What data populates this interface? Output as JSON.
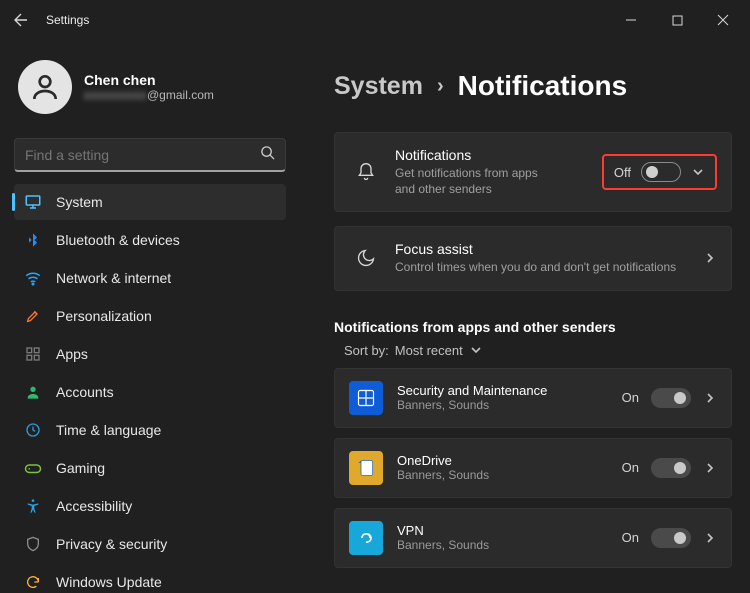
{
  "window": {
    "title": "Settings"
  },
  "profile": {
    "name": "Chen chen",
    "email_masked": "xxxxxxxxx",
    "email_domain": "@gmail.com"
  },
  "search": {
    "placeholder": "Find a setting"
  },
  "nav": {
    "items": [
      {
        "key": "system",
        "label": "System",
        "selected": true,
        "iconColor": "#4cc2ff"
      },
      {
        "key": "bluetooth",
        "label": "Bluetooth & devices",
        "iconColor": "#1f8fff"
      },
      {
        "key": "network",
        "label": "Network & internet",
        "iconColor": "#1fa7ff"
      },
      {
        "key": "personalization",
        "label": "Personalization",
        "iconColor": "#ff7a2a"
      },
      {
        "key": "apps",
        "label": "Apps",
        "iconColor": "#7a7a7a"
      },
      {
        "key": "accounts",
        "label": "Accounts",
        "iconColor": "#2fb96b"
      },
      {
        "key": "time",
        "label": "Time & language",
        "iconColor": "#2f9bd6"
      },
      {
        "key": "gaming",
        "label": "Gaming",
        "iconColor": "#78c53a"
      },
      {
        "key": "accessibility",
        "label": "Accessibility",
        "iconColor": "#2aa0e6"
      },
      {
        "key": "privacy",
        "label": "Privacy & security",
        "iconColor": "#8a8a8a"
      },
      {
        "key": "update",
        "label": "Windows Update",
        "iconColor": "#ffb13b"
      }
    ]
  },
  "breadcrumb": {
    "parent": "System",
    "sep": "›",
    "current": "Notifications"
  },
  "cards": {
    "notifications": {
      "title": "Notifications",
      "sub": "Get notifications from apps and other senders",
      "state": "Off"
    },
    "focus": {
      "title": "Focus assist",
      "sub": "Control times when you do and don't get notifications"
    }
  },
  "section": {
    "heading": "Notifications from apps and other senders",
    "sort_label": "Sort by:",
    "sort_value": "Most recent"
  },
  "apps": [
    {
      "title": "Security and Maintenance",
      "sub": "Banners, Sounds",
      "state": "On",
      "iconBg": "#0f5dd6"
    },
    {
      "title": "OneDrive",
      "sub": "Banners, Sounds",
      "state": "On",
      "iconBg": "#e0a92c"
    },
    {
      "title": "VPN",
      "sub": "Banners, Sounds",
      "state": "On",
      "iconBg": "#17a7d9"
    }
  ]
}
